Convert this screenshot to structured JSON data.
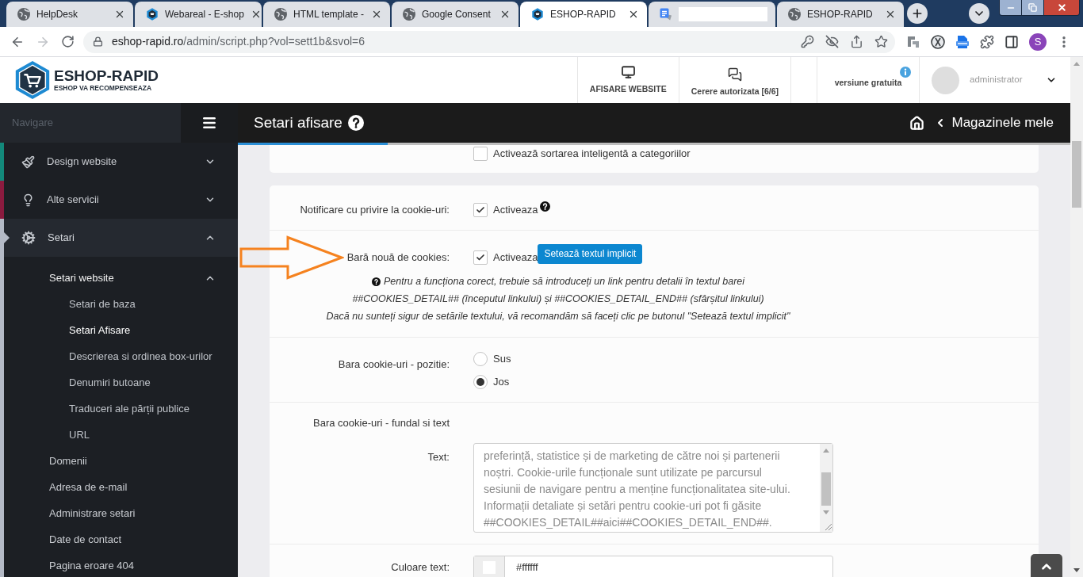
{
  "browser": {
    "tabs": [
      {
        "title": "HelpDesk",
        "kind": "page",
        "selected": false
      },
      {
        "title": "Webareal - E-shop",
        "kind": "eshop",
        "selected": false
      },
      {
        "title": "HTML template -",
        "kind": "page",
        "selected": false
      },
      {
        "title": "Google Consent",
        "kind": "page",
        "selected": false
      },
      {
        "title": "ESHOP-RAPID",
        "kind": "eshop",
        "selected": true
      },
      {
        "kind": "translate",
        "title_hidden": true,
        "selected": false
      },
      {
        "title": "ESHOP-RAPID",
        "kind": "page",
        "selected": false
      }
    ],
    "forward_disabled": true,
    "address": {
      "host": "eshop-rapid.ro",
      "path": "/admin/script.php?vol=sett1b&svol=6"
    },
    "profile_initial": "S"
  },
  "header": {
    "logo": {
      "name": "ESHOP-RAPID",
      "tagline": "ESHOP VA RECOMPENSEAZA"
    },
    "actions": [
      {
        "label": "AFISARE WEBSITE",
        "kind": "website"
      },
      {
        "label": "Cerere autorizata [6/6]",
        "kind": "requests"
      }
    ],
    "plan": "versiune gratuita",
    "user": "administrator"
  },
  "sidebar": {
    "heading": "Navigare",
    "items": [
      {
        "label": "Design website",
        "kind": "design",
        "color": "#13897b",
        "expanded": false
      },
      {
        "label": "Alte servicii",
        "kind": "services",
        "color": "#8b1b3f",
        "expanded": false
      },
      {
        "label": "Setari",
        "kind": "settings",
        "color": "#b4bac6",
        "expanded": true,
        "children": [
          {
            "label": "Setari website",
            "expanded": true,
            "children": [
              {
                "label": "Setari de baza",
                "selected": false
              },
              {
                "label": "Setari Afisare",
                "selected": true
              },
              {
                "label": "Descrierea si ordinea box-urilor",
                "selected": false
              },
              {
                "label": "Denumiri butoane",
                "selected": false
              },
              {
                "label": "Traduceri ale părții publice",
                "selected": false
              },
              {
                "label": "URL",
                "selected": false
              }
            ]
          },
          {
            "label": "Domenii",
            "selected": false
          },
          {
            "label": "Adresa de e-mail",
            "selected": false
          },
          {
            "label": "Administrare setari",
            "selected": false
          },
          {
            "label": "Date de contact",
            "selected": false
          },
          {
            "label": "Pagina eroare 404",
            "selected": false
          }
        ]
      }
    ]
  },
  "title_bar": {
    "title": "Setari afisare",
    "breadcrumb": "Magazinele mele"
  },
  "loading_bar": {
    "level": 0.18
  },
  "settings": {
    "partial_card": {
      "option": "Activează sortarea inteligentă a categoriilor",
      "checked": false
    },
    "rows": [
      {
        "kind": "checkbox",
        "label": "Notificare cu privire la cookie-uri:",
        "option": "Activeaza",
        "checked": true,
        "help_icon": true
      },
      {
        "kind": "checkbox",
        "label": "Bară nouă de cookies:",
        "option": "Activeaza",
        "checked": true,
        "button": "Setează textul implicit",
        "annotation_arrow": true,
        "note": [
          "Pentru a funcționa corect, trebuie să introduceți un link pentru detalii în textul barei",
          "##COOKIES_DETAIL## (începutul linkului) și ##COOKIES_DETAIL_END## (sfârșitul linkului)",
          "Dacă nu sunteți sigur de setările textului, vă recomandăm să faceți clic pe butonul \"Setează textul implicit\""
        ]
      },
      {
        "kind": "radio",
        "label": "Bara cookie-uri - pozitie:",
        "options": [
          {
            "label": "Sus",
            "selected": false
          },
          {
            "label": "Jos",
            "selected": true
          }
        ]
      },
      {
        "kind": "textarea",
        "heading": "Bara cookie-uri - fundal si text",
        "label": "Text:",
        "value": "preferință, statistice și de marketing de către noi și partenerii\nnoștri. Cookie-urile funcționale sunt utilizate pe parcursul\nsesiunii de navigare pentru a menține funcționalitatea site-ului.\nInformații detaliate și setări pentru cookie-uri pot fi găsite\n##COOKIES_DETAIL##aici##COOKIES_DETAIL_END##."
      },
      {
        "kind": "color",
        "label": "Culoare text:",
        "value": "#ffffff"
      }
    ]
  }
}
